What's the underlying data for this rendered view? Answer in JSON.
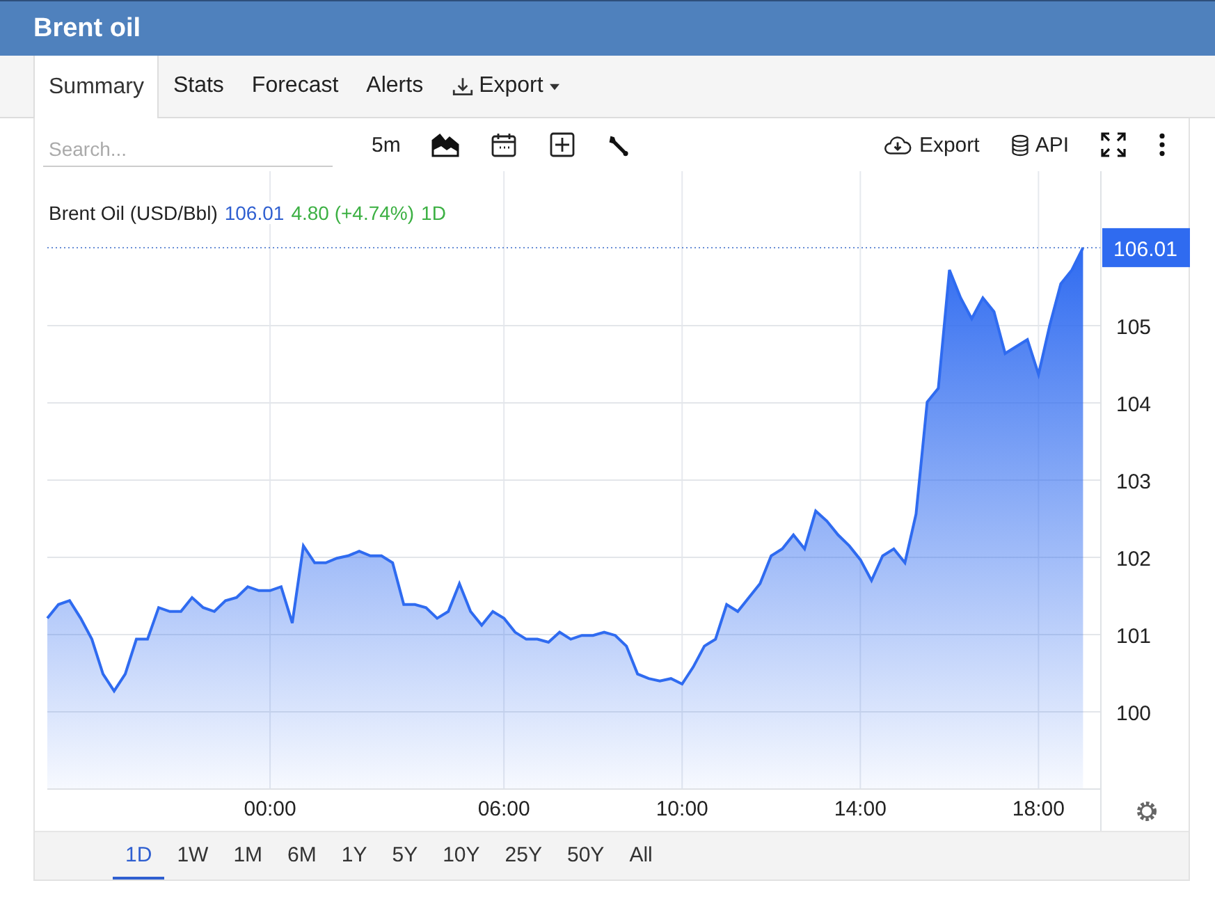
{
  "window": {
    "title": "Brent oil"
  },
  "tabs": [
    {
      "label": "Summary",
      "selected": true,
      "kind": "plain"
    },
    {
      "label": "Stats",
      "selected": false,
      "kind": "plain"
    },
    {
      "label": "Forecast",
      "selected": false,
      "kind": "plain"
    },
    {
      "label": "Alerts",
      "selected": false,
      "kind": "plain"
    },
    {
      "label": "Export",
      "selected": false,
      "kind": "dropdown"
    }
  ],
  "toolbar": {
    "search": {
      "placeholder": "Search..."
    },
    "interval": "5m",
    "export_label": "Export",
    "api_label": "API"
  },
  "legend": {
    "price": "106.01",
    "change": "4.80 (+4.74%)",
    "period": "1D"
  },
  "last_price_label": "106.01",
  "chart_data": {
    "type": "area",
    "ylim": [
      99,
      107
    ],
    "grid": true,
    "ref_lines": [
      {
        "axis": "y",
        "value": 106.01
      }
    ],
    "yticks": [
      100,
      101,
      102,
      103,
      104,
      105
    ],
    "categories": [
      null,
      null,
      null,
      null,
      null,
      null,
      null,
      null,
      null,
      null,
      null,
      null,
      null,
      null,
      null,
      null,
      null,
      null,
      null,
      null,
      "00:00",
      null,
      null,
      null,
      null,
      null,
      null,
      null,
      null,
      null,
      null,
      null,
      null,
      null,
      null,
      null,
      null,
      null,
      null,
      null,
      null,
      "06:00",
      null,
      null,
      null,
      null,
      null,
      null,
      null,
      null,
      null,
      null,
      null,
      null,
      null,
      null,
      null,
      "10:00",
      null,
      null,
      null,
      null,
      null,
      null,
      null,
      null,
      null,
      null,
      null,
      null,
      null,
      null,
      null,
      "14:00",
      null,
      null,
      null,
      null,
      null,
      null,
      null,
      null,
      null,
      null,
      null,
      null,
      null,
      null,
      null,
      "18:00",
      null,
      null,
      null,
      null
    ],
    "series": [
      {
        "name": "Brent Oil (USD/Bbl)",
        "color": "#2f6bf0",
        "values": [
          101.21,
          101.39,
          101.44,
          101.21,
          100.94,
          100.49,
          100.27,
          100.49,
          100.94,
          100.94,
          101.35,
          101.3,
          101.3,
          101.48,
          101.35,
          101.3,
          101.44,
          101.48,
          101.62,
          101.57,
          101.57,
          101.62,
          101.15,
          102.15,
          101.93,
          101.93,
          101.99,
          102.02,
          102.08,
          102.02,
          102.02,
          101.93,
          101.39,
          101.39,
          101.35,
          101.21,
          101.3,
          101.66,
          101.3,
          101.12,
          101.3,
          101.21,
          101.03,
          100.94,
          100.94,
          100.9,
          101.03,
          100.94,
          100.99,
          100.99,
          101.03,
          100.99,
          100.85,
          100.49,
          100.43,
          100.4,
          100.43,
          100.36,
          100.58,
          100.85,
          100.94,
          101.39,
          101.3,
          101.48,
          101.66,
          102.02,
          102.11,
          102.29,
          102.11,
          102.6,
          102.47,
          102.29,
          102.15,
          101.97,
          101.7,
          102.02,
          102.11,
          101.93,
          102.56,
          104.01,
          104.19,
          105.72,
          105.36,
          105.09,
          105.36,
          105.18,
          104.64,
          104.73,
          104.82,
          104.37,
          105.0,
          105.54,
          105.72,
          106.01
        ]
      }
    ]
  },
  "ranges": [
    {
      "label": "1D",
      "selected": true
    },
    {
      "label": "1W",
      "selected": false
    },
    {
      "label": "1M",
      "selected": false
    },
    {
      "label": "6M",
      "selected": false
    },
    {
      "label": "1Y",
      "selected": false
    },
    {
      "label": "5Y",
      "selected": false
    },
    {
      "label": "10Y",
      "selected": false
    },
    {
      "label": "25Y",
      "selected": false
    },
    {
      "label": "50Y",
      "selected": false
    },
    {
      "label": "All",
      "selected": false
    }
  ]
}
